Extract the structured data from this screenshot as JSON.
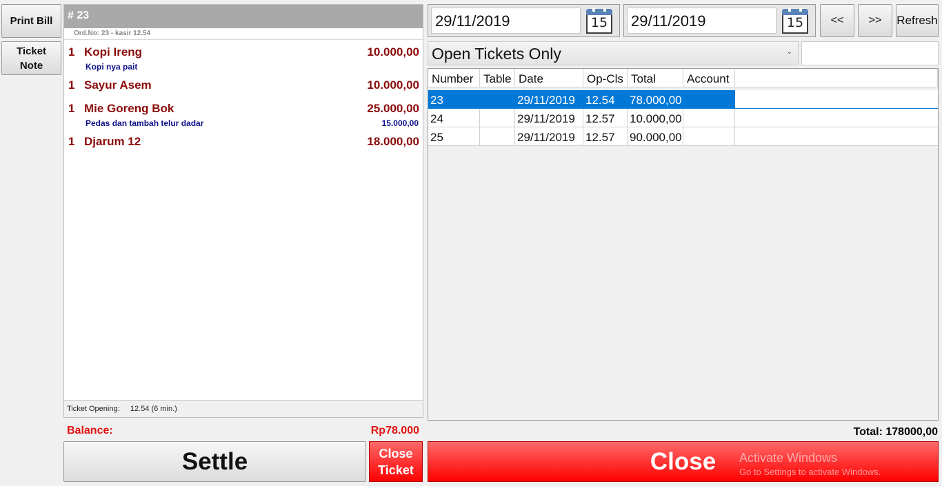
{
  "sidebar": {
    "print_bill": "Print Bill",
    "ticket_note_1": "Ticket",
    "ticket_note_2": "Note"
  },
  "ticket": {
    "title": "# 23",
    "subtitle": "Ord.No: 23 - kasir  12.54",
    "items": [
      {
        "qty": "1",
        "name": "Kopi Ireng",
        "price": "10.000,00",
        "note": "Kopi nya pait",
        "note_price": ""
      },
      {
        "qty": "1",
        "name": "Sayur Asem",
        "price": "10.000,00",
        "note": "",
        "note_price": ""
      },
      {
        "qty": "1",
        "name": "Mie Goreng Bok",
        "price": "25.000,00",
        "note": "Pedas dan tambah telur dadar",
        "note_price": "15.000,00"
      },
      {
        "qty": "1",
        "name": "Djarum 12",
        "price": "18.000,00",
        "note": "",
        "note_price": ""
      }
    ],
    "opening_label": "Ticket Opening:",
    "opening_value": "12.54 (6 min.)"
  },
  "balance": {
    "label": "Balance:",
    "value": "Rp78.000"
  },
  "buttons": {
    "settle": "Settle",
    "close_ticket_1": "Close",
    "close_ticket_2": "Ticket",
    "close": "Close",
    "prev": "<<",
    "next": ">>",
    "refresh": "Refresh"
  },
  "dates": {
    "from": "29/11/2019",
    "to": "29/11/2019",
    "calendar_day": "15"
  },
  "filter": {
    "selected": "Open Tickets Only"
  },
  "grid": {
    "columns": [
      "Number",
      "Table",
      "Date",
      "Op-Cls",
      "Total",
      "Account"
    ],
    "rows": [
      {
        "number": "23",
        "table": "",
        "date": "29/11/2019",
        "opcls": "12.54",
        "total": "78.000,00",
        "account": "",
        "selected": true
      },
      {
        "number": "24",
        "table": "",
        "date": "29/11/2019",
        "opcls": "12.57",
        "total": "10.000,00",
        "account": "",
        "selected": false
      },
      {
        "number": "25",
        "table": "",
        "date": "29/11/2019",
        "opcls": "12.57",
        "total": "90.000,00",
        "account": "",
        "selected": false
      }
    ]
  },
  "total": "Total: 178000,00",
  "watermark": {
    "line1": "Activate Windows",
    "line2": "Go to Settings to activate Windows."
  },
  "colors": {
    "accent_red": "#ff2a2a",
    "selection_blue": "#0078d7",
    "item_text": "#8b0a0a",
    "note_text": "#10108a"
  }
}
